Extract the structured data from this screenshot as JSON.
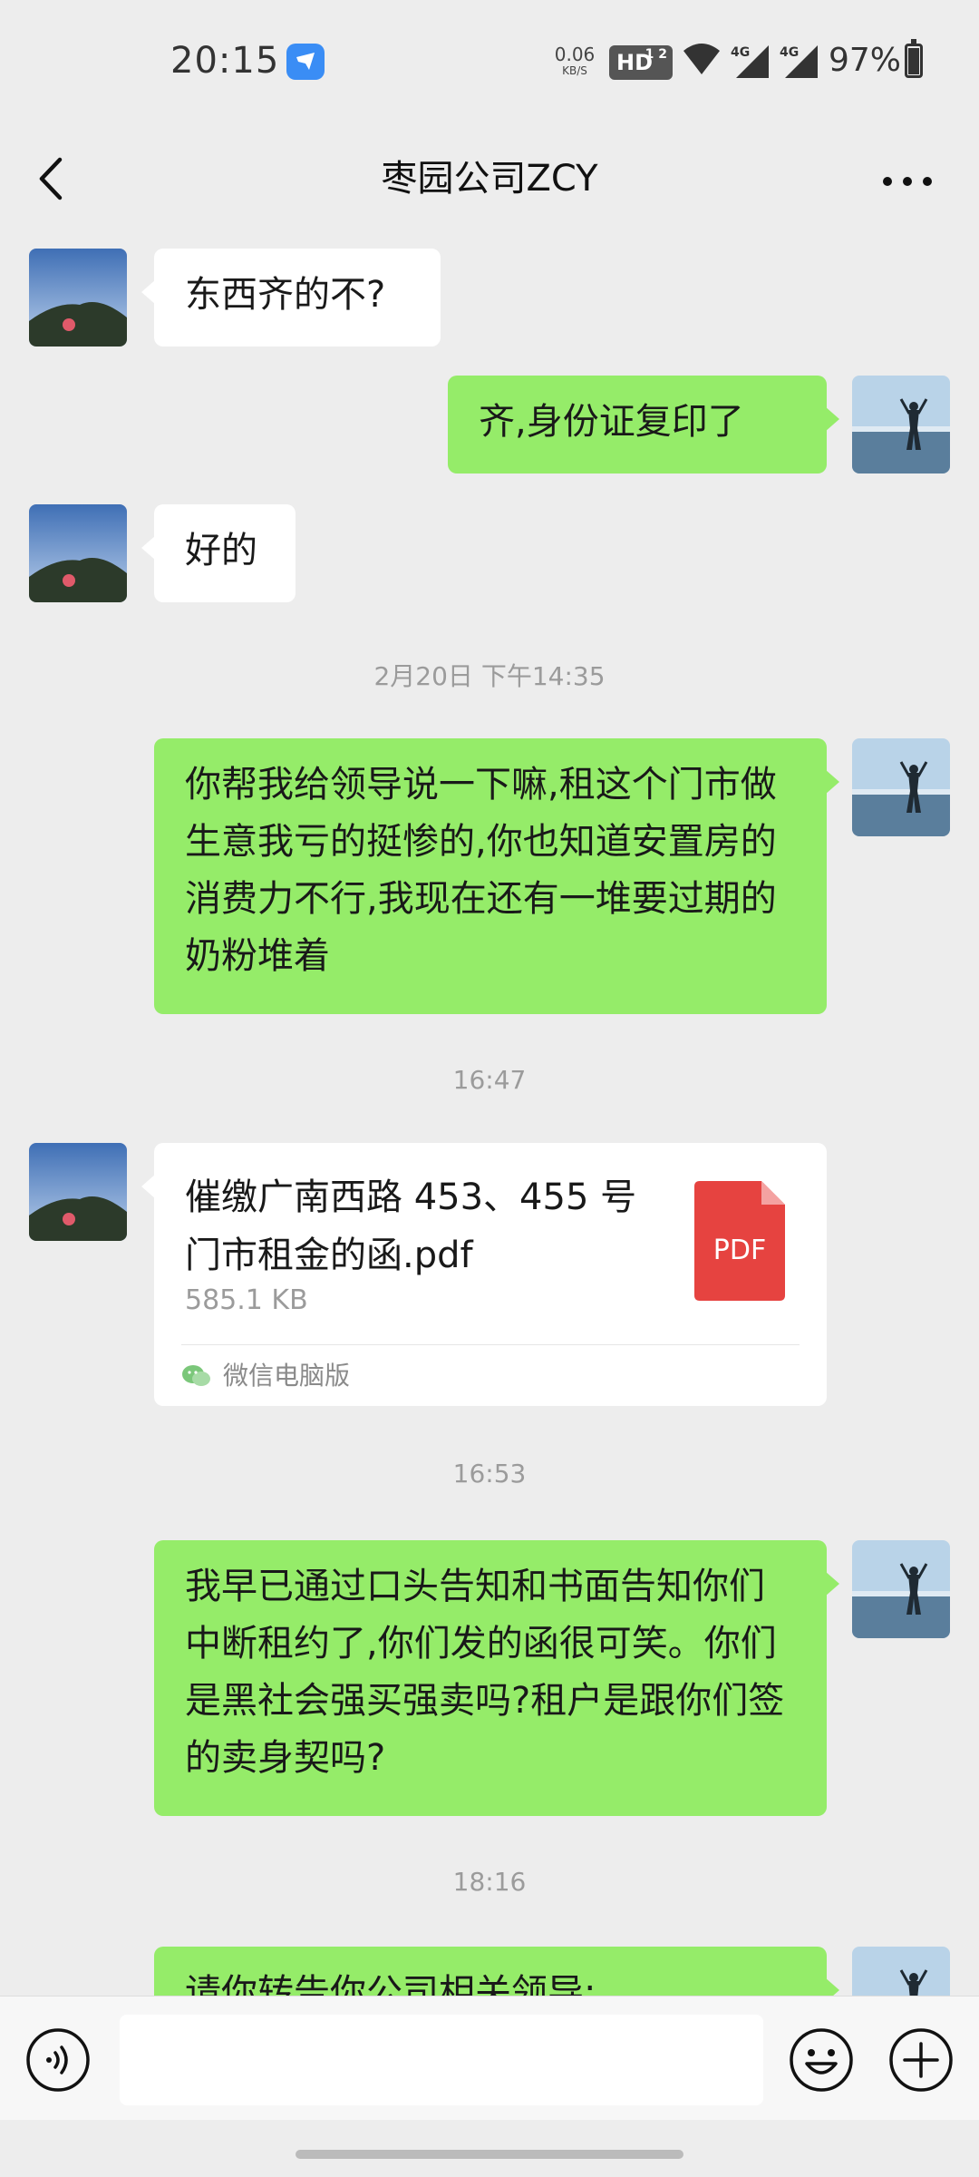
{
  "status_bar": {
    "time": "20:15",
    "net_speed_value": "0.06",
    "net_speed_unit": "KB/S",
    "hd_label": "HD",
    "hd_sub": "1 2",
    "signal1_label": "4G",
    "signal2_label": "4G",
    "battery": "97%",
    "battery_level": 0.97
  },
  "header": {
    "title": "枣园公司ZCY"
  },
  "messages": {
    "m1": "东西齐的不?",
    "m2": "齐,身份证复印了",
    "m3": "好的",
    "ts1": "2月20日 下午14:35",
    "m4": "你帮我给领导说一下嘛,租这个门市做生意我亏的挺惨的,你也知道安置房的消费力不行,我现在还有一堆要过期的奶粉堆着",
    "ts2": "16:47",
    "file": {
      "name": "催缴广南西路 453、455 号门市租金的函.pdf",
      "size": "585.1 KB",
      "type_label": "PDF",
      "source": "微信电脑版"
    },
    "ts3": "16:53",
    "m5": "我早已通过口头告知和书面告知你们中断租约了,你们发的函很可笑。你们是黑社会强买强卖吗?租户是跟你们签的卖身契吗?",
    "ts4": "18:16",
    "m6": "请你转告你公司相关领导:"
  },
  "colors": {
    "background": "#ededed",
    "outgoing_bubble": "#95ec69",
    "incoming_bubble": "#ffffff",
    "pdf_red": "#e64340"
  }
}
